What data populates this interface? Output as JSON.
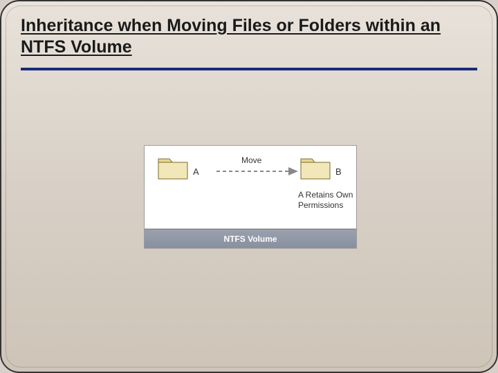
{
  "title": "Inheritance when Moving Files or Folders within an NTFS Volume",
  "diagram": {
    "folderA": "A",
    "folderB": "B",
    "action": "Move",
    "note": "A Retains Own Permissions",
    "volume": "NTFS Volume"
  }
}
